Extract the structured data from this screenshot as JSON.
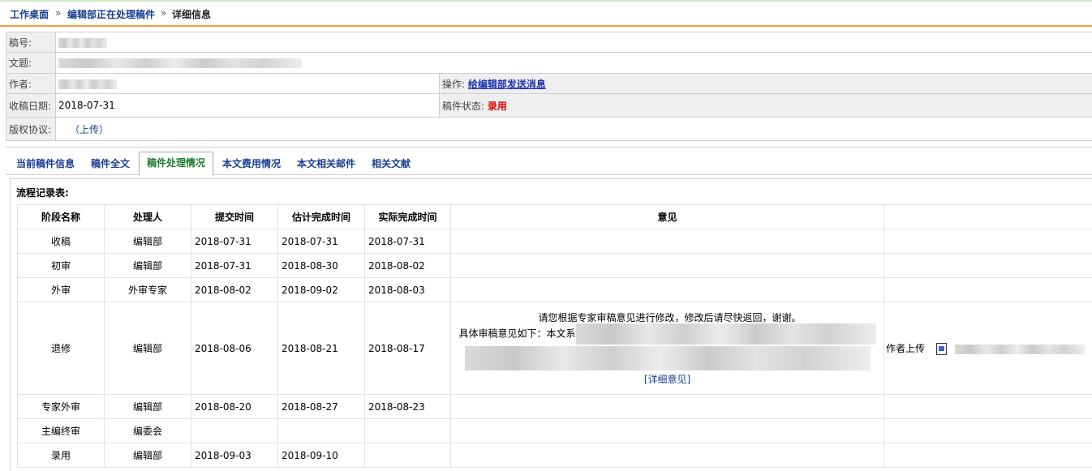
{
  "breadcrumb": {
    "items": [
      "工作桌面",
      "编辑部正在处理稿件",
      "详细信息"
    ],
    "separator": "»"
  },
  "manuscript": {
    "id_label": "稿号:",
    "title_label": "文题:",
    "author_label": "作者:",
    "received_label": "收稿日期:",
    "received_date": "2018-07-31",
    "copyright_label": "版权协议:",
    "copyright_upload": "（上传）",
    "operation_label": "操作:",
    "operation_link": "给编辑部发送消息",
    "status_label": "稿件状态:",
    "status_value": "录用"
  },
  "tabs": [
    {
      "label": "当前稿件信息",
      "active": false
    },
    {
      "label": "稿件全文",
      "active": false
    },
    {
      "label": "稿件处理情况",
      "active": true
    },
    {
      "label": "本文费用情况",
      "active": false
    },
    {
      "label": "本文相关邮件",
      "active": false
    },
    {
      "label": "相关文献",
      "active": false
    }
  ],
  "flow": {
    "title": "流程记录表:",
    "headers": [
      "阶段名称",
      "处理人",
      "提交时间",
      "估计完成时间",
      "实际完成时间",
      "意见",
      ""
    ],
    "rows": [
      {
        "stage": "收稿",
        "handler": "编辑部",
        "submitted": "2018-07-31",
        "estimated": "2018-07-31",
        "actual": "2018-07-31"
      },
      {
        "stage": "初审",
        "handler": "编辑部",
        "submitted": "2018-07-31",
        "estimated": "2018-08-30",
        "actual": "2018-08-02"
      },
      {
        "stage": "外审",
        "handler": "外审专家",
        "submitted": "2018-08-02",
        "estimated": "2018-09-02",
        "actual": "2018-08-03"
      },
      {
        "stage": "退修",
        "handler": "编辑部",
        "submitted": "2018-08-06",
        "estimated": "2018-08-21",
        "actual": "2018-08-17",
        "opinion_line1": "请您根据专家审稿意见进行修改，修改后请尽快返回，谢谢。",
        "opinion_line2": "具体审稿意见如下：本文系",
        "detail_link": "[详细意见]",
        "author_upload": "作者上传"
      },
      {
        "stage": "专家外审",
        "handler": "编辑部",
        "submitted": "2018-08-20",
        "estimated": "2018-08-27",
        "actual": "2018-08-23"
      },
      {
        "stage": "主编终审",
        "handler": "编委会",
        "submitted": "",
        "estimated": "",
        "actual": ""
      },
      {
        "stage": "录用",
        "handler": "编辑部",
        "submitted": "2018-09-03",
        "estimated": "2018-09-10",
        "actual": ""
      }
    ]
  },
  "colors": {
    "link": "#1a3d8f",
    "status": "#e00000",
    "active_tab": "#1e7c2a",
    "accent_rule": "#f0a13a"
  }
}
